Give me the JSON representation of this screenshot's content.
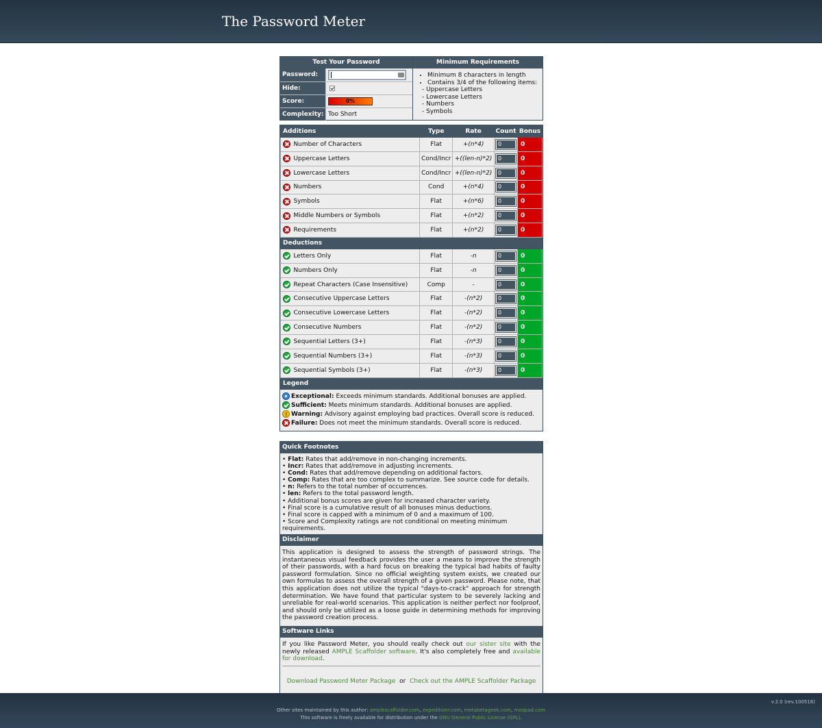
{
  "header": {
    "title": "The Password Meter"
  },
  "test": {
    "title": "Test Your Password",
    "password_label": "Password:",
    "hide_label": "Hide:",
    "score_label": "Score:",
    "score_value": "0%",
    "complexity_label": "Complexity:",
    "complexity_value": "Too Short"
  },
  "requirements": {
    "title": "Minimum Requirements",
    "item1": "Minimum 8 characters in length",
    "item2": "Contains 3/4 of the following items:",
    "sub1": "- Uppercase Letters",
    "sub2": "- Lowercase Letters",
    "sub3": "- Numbers",
    "sub4": "- Symbols"
  },
  "columns": {
    "additions": "Additions",
    "type": "Type",
    "rate": "Rate",
    "count": "Count",
    "bonus": "Bonus",
    "deductions": "Deductions"
  },
  "additions": [
    {
      "name": "Number of Characters",
      "type": "Flat",
      "rate": "+(n*4)",
      "count": "0",
      "bonus": "0"
    },
    {
      "name": "Uppercase Letters",
      "type": "Cond/Incr",
      "rate": "+((len-n)*2)",
      "count": "0",
      "bonus": "0"
    },
    {
      "name": "Lowercase Letters",
      "type": "Cond/Incr",
      "rate": "+((len-n)*2)",
      "count": "0",
      "bonus": "0"
    },
    {
      "name": "Numbers",
      "type": "Cond",
      "rate": "+(n*4)",
      "count": "0",
      "bonus": "0"
    },
    {
      "name": "Symbols",
      "type": "Flat",
      "rate": "+(n*6)",
      "count": "0",
      "bonus": "0"
    },
    {
      "name": "Middle Numbers or Symbols",
      "type": "Flat",
      "rate": "+(n*2)",
      "count": "0",
      "bonus": "0"
    },
    {
      "name": "Requirements",
      "type": "Flat",
      "rate": "+(n*2)",
      "count": "0",
      "bonus": "0"
    }
  ],
  "deductions": [
    {
      "name": "Letters Only",
      "type": "Flat",
      "rate": "-n",
      "count": "0",
      "bonus": "0"
    },
    {
      "name": "Numbers Only",
      "type": "Flat",
      "rate": "-n",
      "count": "0",
      "bonus": "0"
    },
    {
      "name": "Repeat Characters (Case Insensitive)",
      "type": "Comp",
      "rate": "-",
      "count": "0",
      "bonus": "0"
    },
    {
      "name": "Consecutive Uppercase Letters",
      "type": "Flat",
      "rate": "-(n*2)",
      "count": "0",
      "bonus": "0"
    },
    {
      "name": "Consecutive Lowercase Letters",
      "type": "Flat",
      "rate": "-(n*2)",
      "count": "0",
      "bonus": "0"
    },
    {
      "name": "Consecutive Numbers",
      "type": "Flat",
      "rate": "-(n*2)",
      "count": "0",
      "bonus": "0"
    },
    {
      "name": "Sequential Letters (3+)",
      "type": "Flat",
      "rate": "-(n*3)",
      "count": "0",
      "bonus": "0"
    },
    {
      "name": "Sequential Numbers (3+)",
      "type": "Flat",
      "rate": "-(n*3)",
      "count": "0",
      "bonus": "0"
    },
    {
      "name": "Sequential Symbols (3+)",
      "type": "Flat",
      "rate": "-(n*3)",
      "count": "0",
      "bonus": "0"
    }
  ],
  "legend": {
    "title": "Legend",
    "exceptional_label": "Exceptional:",
    "exceptional_text": "Exceeds minimum standards. Additional bonuses are applied.",
    "sufficient_label": "Sufficient:",
    "sufficient_text": "Meets minimum standards. Additional bonuses are applied.",
    "warning_label": "Warning:",
    "warning_text": "Advisory against employing bad practices. Overall score is reduced.",
    "failure_label": "Failure:",
    "failure_text": "Does not meet the minimum standards. Overall score is reduced."
  },
  "footnotes": {
    "title": "Quick Footnotes",
    "flat_label": "Flat:",
    "flat_text": "Rates that add/remove in non-changing increments.",
    "incr_label": "Incr:",
    "incr_text": "Rates that add/remove in adjusting increments.",
    "cond_label": "Cond:",
    "cond_text": "Rates that add/remove depending on additional factors.",
    "comp_label": "Comp:",
    "comp_text": "Rates that are too complex to summarize. See source code for details.",
    "n_label": "n:",
    "n_text": "Refers to the total number of occurrences.",
    "len_label": "len:",
    "len_text": "Refers to the total password length.",
    "note1": "Additional bonus scores are given for increased character variety.",
    "note2": "Final score is a cumulative result of all bonuses minus deductions.",
    "note3": "Final score is capped with a minimum of 0 and a maximum of 100.",
    "note4": "Score and Complexity ratings are not conditional on meeting minimum requirements."
  },
  "disclaimer": {
    "title": "Disclaimer",
    "text": "This application is designed to assess the strength of password strings. The instantaneous visual feedback provides the user a means to improve the strength of their passwords, with a hard focus on breaking the typical bad habits of faulty password formulation. Since no official weighting system exists, we created our own formulas to assess the overall strength of a given password. Please note, that this application does not utilize the typical \"days-to-crack\" approach for strength determination. We have found that particular system to be severely lacking and unreliable for real-world scenarios. This application is neither perfect nor foolproof, and should only be utilized as a loose guide in determining methods for improving the password creation process."
  },
  "links": {
    "title": "Software Links",
    "text1": "If you like Password Meter, you should really check out",
    "sister_link": "our sister site",
    "text2": "with the newly released",
    "ample_link": "AMPLE Scaffolder software",
    "text3": ". It's also completely free and",
    "download_link": "available for download",
    "text4": ".",
    "pkg_link": "Download Password Meter Package",
    "or": "or",
    "ample_pkg_link": "Check out the AMPLE Scaffolder Package"
  },
  "footer": {
    "version": "v.2.0 (rev.100518)",
    "other_sites": "Other sites maintained by this author:",
    "site1": "amplescaffolder.com",
    "site2": "expeditionr.com",
    "site3": "metabetageek.com",
    "site4": "moopad.com",
    "license_prefix": "This software is freely available for distribution under the",
    "license_link": "GNU General Public License (GPL)",
    "license_suffix": "."
  },
  "colors": {
    "header": "#2c3d4c",
    "section": "#435563",
    "bonus_fail": "#d40000",
    "bonus_pass": "#00a628",
    "link": "#4a8b3a"
  }
}
